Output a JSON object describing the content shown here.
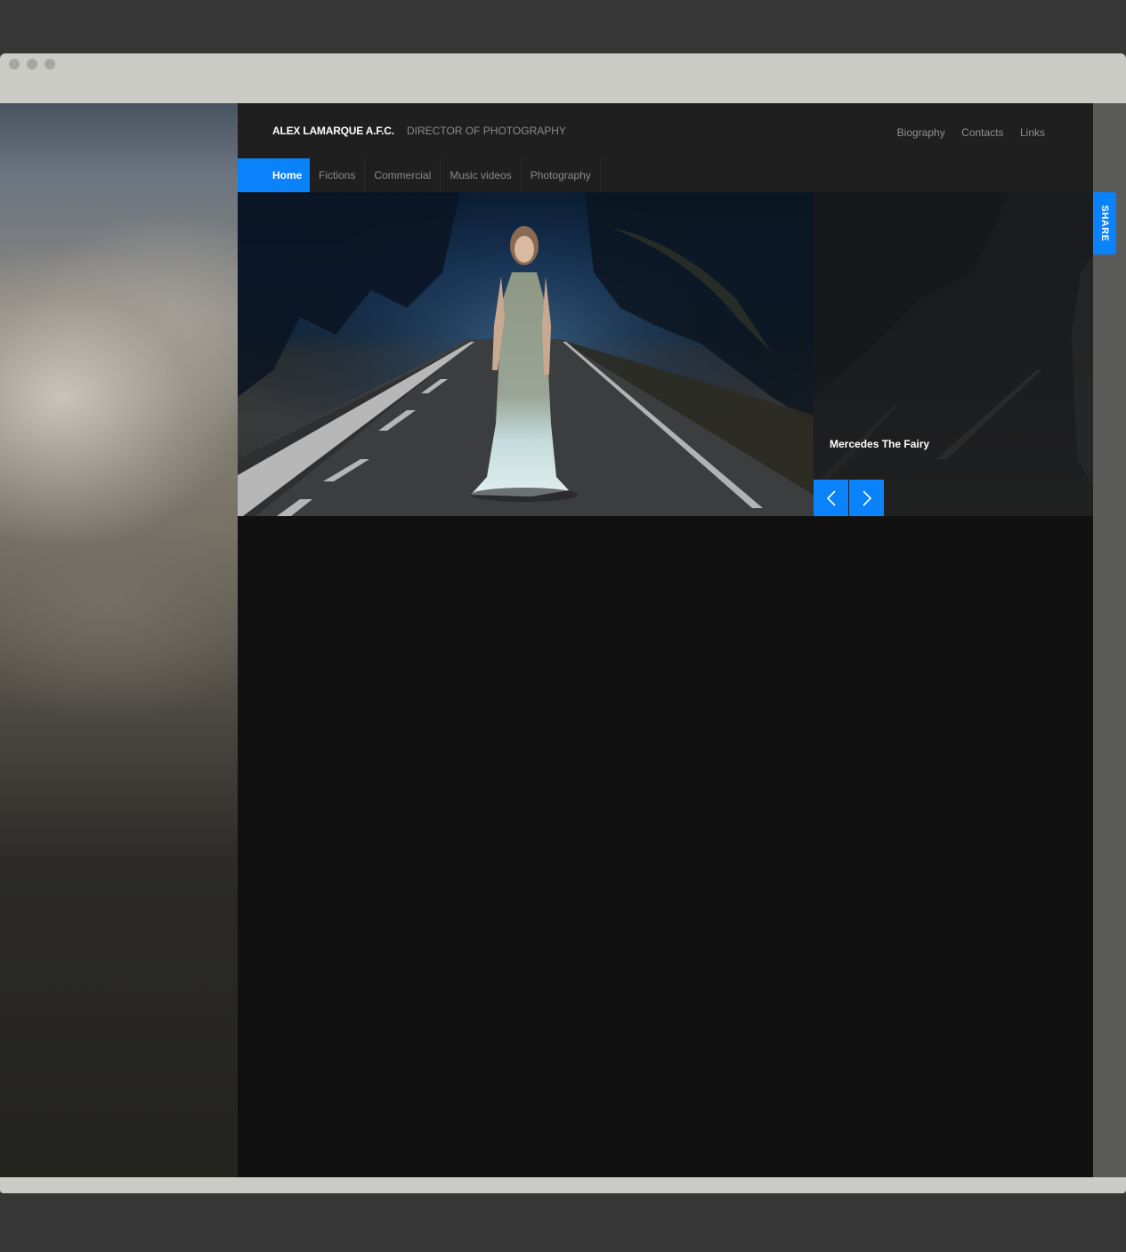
{
  "site": {
    "name": "ALEX LAMARQUE A.F.C.",
    "subtitle": "DIRECTOR OF PHOTOGRAPHY"
  },
  "top_links": [
    {
      "label": "Biography"
    },
    {
      "label": "Contacts"
    },
    {
      "label": "Links"
    }
  ],
  "main_nav": [
    {
      "label": "Home",
      "active": true
    },
    {
      "label": "Fictions"
    },
    {
      "label": "Commercial"
    },
    {
      "label": "Music videos"
    },
    {
      "label": "Photography"
    }
  ],
  "slider": {
    "caption": "Mercedes The Fairy",
    "prev_icon": "chevron-left-icon",
    "next_icon": "chevron-right-icon"
  },
  "share": {
    "label": "SHARE"
  },
  "colors": {
    "accent": "#0a82fa",
    "page_bg": "#121111",
    "header_bg": "#1f1f1f"
  }
}
